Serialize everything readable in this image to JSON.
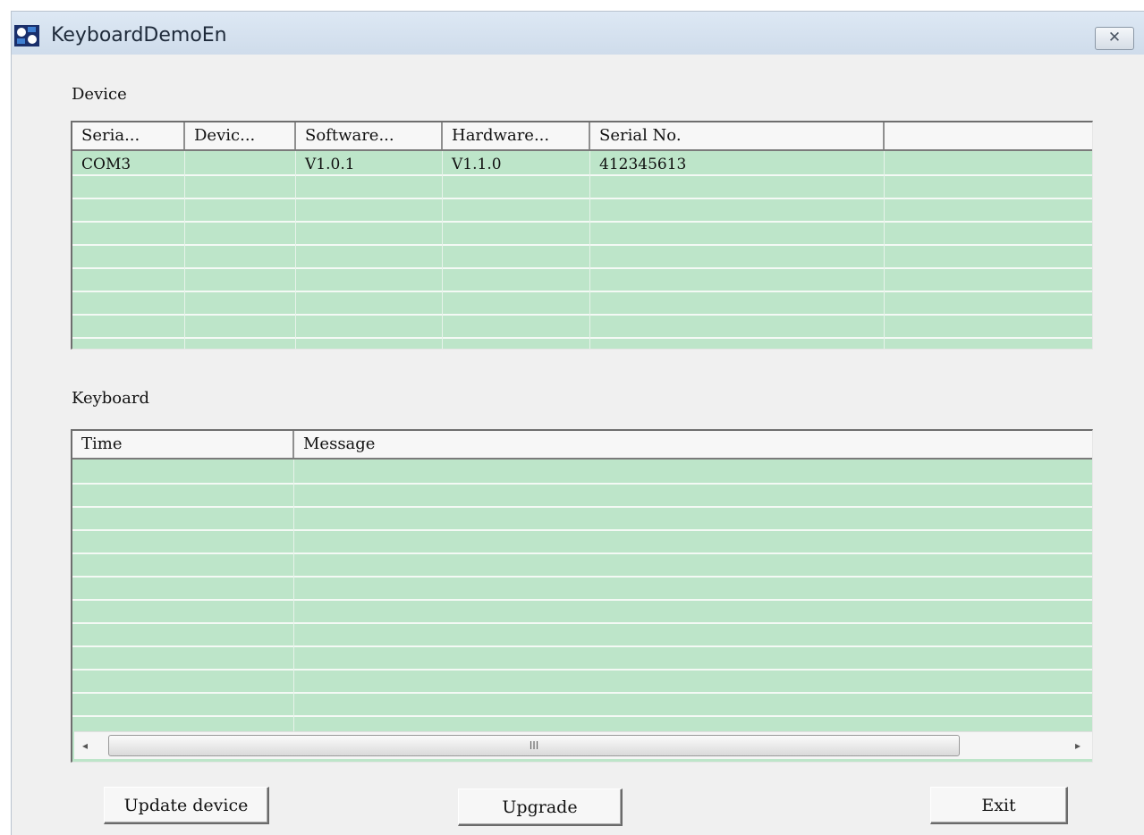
{
  "window": {
    "title": "KeyboardDemoEn",
    "close_glyph": "✕"
  },
  "device": {
    "label": "Device",
    "columns": [
      "Seria...",
      "Devic...",
      "Software...",
      "Hardware...",
      "Serial No.",
      ""
    ],
    "rows": [
      [
        "COM3",
        "",
        "V1.0.1",
        "V1.1.0",
        "412345613",
        ""
      ]
    ]
  },
  "keyboard": {
    "label": "Keyboard",
    "columns": [
      "Time",
      "Message"
    ],
    "rows": [],
    "scrollbar": {
      "left_arrow": "◂",
      "right_arrow": "▸",
      "thumb_grip": "III"
    }
  },
  "buttons": {
    "update_device": "Update device",
    "upgrade": "Upgrade",
    "exit": "Exit"
  },
  "colors": {
    "grid_background": "#bde5c9",
    "window_background": "#f0f0f0",
    "titlebar": "#d6e2ef"
  }
}
